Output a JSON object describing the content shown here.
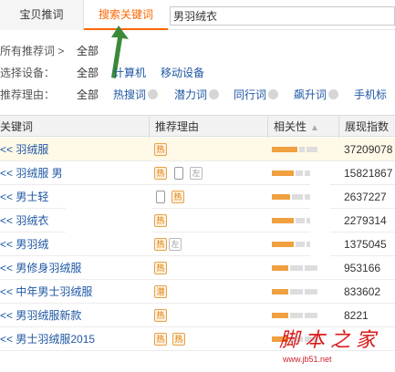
{
  "tabs": [
    {
      "label": "宝贝推词",
      "active": false
    },
    {
      "label": "搜索关键词",
      "active": true
    }
  ],
  "search": {
    "value": "男羽绒衣"
  },
  "filters": {
    "recommended": {
      "label": "所有推荐词 >",
      "option": "全部"
    },
    "device": {
      "label": "选择设备：",
      "options": [
        "全部",
        "计算机",
        "移动设备"
      ]
    },
    "reason": {
      "label": "推荐理由：",
      "options": [
        "全部",
        "热搜词",
        "潜力词",
        "同行词",
        "飙升词",
        "手机标"
      ]
    }
  },
  "table": {
    "headers": [
      "关键词",
      "推荐理由",
      "相关性",
      "展现指数"
    ],
    "rows": [
      {
        "keyword": "<< 羽绒服",
        "tags": [
          "热"
        ],
        "relevance": 5,
        "index": "37209078",
        "highlight": true
      },
      {
        "keyword": "<< 羽绒服 男",
        "tags": [
          "热",
          "phone",
          "左"
        ],
        "relevance": 4,
        "index": "15821867"
      },
      {
        "keyword": "<< 男士轻",
        "tags": [
          "phone",
          "热"
        ],
        "relevance": 3,
        "index": "2637227"
      },
      {
        "keyword": "<< 羽绒衣",
        "tags": [
          "热"
        ],
        "relevance": 4,
        "index": "2279314"
      },
      {
        "keyword": "<< 男羽绒",
        "tags": [
          "热",
          "左"
        ],
        "relevance": 4,
        "index": "1375045"
      },
      {
        "keyword": "<< 男修身羽绒服",
        "tags": [
          "热"
        ],
        "relevance": 3,
        "index": "953166"
      },
      {
        "keyword": "<< 中年男士羽绒服",
        "tags": [
          "潜"
        ],
        "relevance": 3,
        "index": "833602"
      },
      {
        "keyword": "<< 男羽绒服新款",
        "tags": [
          "热"
        ],
        "relevance": 3,
        "index": "8221"
      },
      {
        "keyword": "<< 男士羽绒服2015",
        "tags": [
          "热",
          "热"
        ],
        "relevance": 3,
        "index": ""
      }
    ]
  },
  "watermark": {
    "big": "脚本之家",
    "small": "www.jb51.net"
  },
  "colors": {
    "accent": "#ff6600",
    "link": "#1f57a3",
    "bar": "#f0a040",
    "arrow": "#3a8a3a"
  }
}
